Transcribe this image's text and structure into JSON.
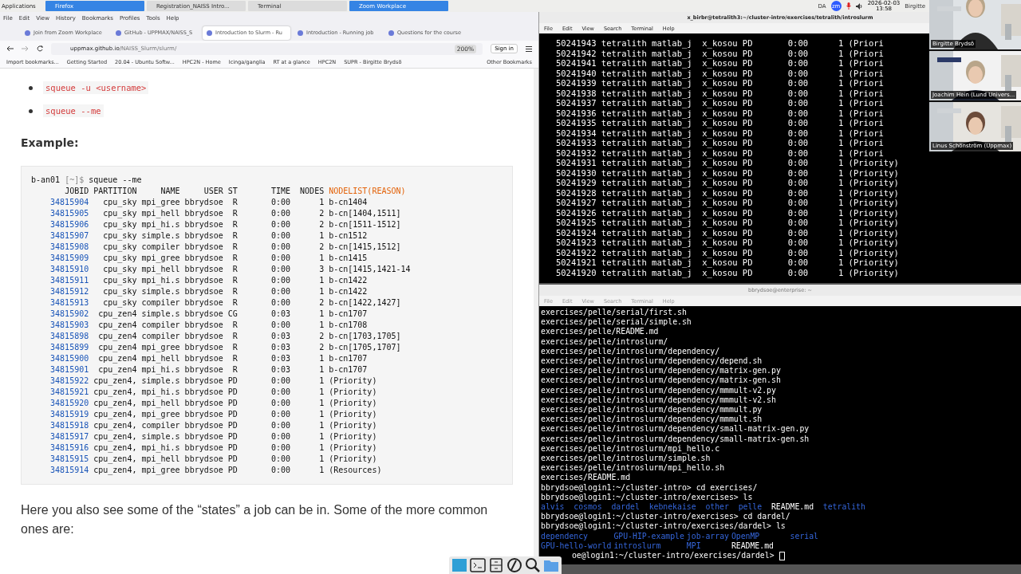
{
  "top_panel": {
    "menu": "Applications",
    "tasks": [
      {
        "label": "Firefox",
        "selected": true
      },
      {
        "label": "Registration_NAISS Intro...",
        "selected": false
      },
      {
        "label": "Terminal",
        "selected": false
      },
      {
        "label": "Zoom Workplace",
        "selected": true
      }
    ],
    "tray": {
      "lang": "DA",
      "zoom": "zm",
      "date": "2026-02-03",
      "time": "13:58",
      "user": "Birgitte"
    }
  },
  "browser": {
    "menu": [
      "File",
      "Edit",
      "View",
      "History",
      "Bookmarks",
      "Profiles",
      "Tools",
      "Help"
    ],
    "tabs": [
      {
        "label": "Join from Zoom Workplace",
        "selected": false
      },
      {
        "label": "GitHub - UPPMAX/NAISS_S",
        "selected": false
      },
      {
        "label": "Introduction to Slurm - Ru",
        "selected": true
      },
      {
        "label": "Introduction - Running job",
        "selected": false
      },
      {
        "label": "Questions for the course",
        "selected": false
      }
    ],
    "url_host": "uppmax.github.io",
    "url_path": "/NAISS_Slurm/slurm/",
    "zoom": "200%",
    "sign_in": "Sign in",
    "bookmarks": [
      "Import bookmarks...",
      "Getting Started",
      "20.04 - Ubuntu Softw...",
      "HPC2N - Home",
      "Icinga/ganglia",
      "RT at a glance",
      "HPC2N",
      "SUPR - Birgitte Brydsö"
    ],
    "other_bookmarks": "Other Bookmarks",
    "page": {
      "bullets": [
        "squeue -u <username>",
        "squeue --me"
      ],
      "heading": "Example:",
      "code": {
        "prompt_host": "b-an01",
        "prompt_dir": "[~]$",
        "command": "squeue --me",
        "header": [
          "JOBID",
          "PARTITION",
          "NAME",
          "USER",
          "ST",
          "TIME",
          "NODES",
          "NODELIST(REASON)"
        ],
        "rows": [
          [
            "34815904",
            "cpu_sky",
            "mpi_gree",
            "bbrydsoe",
            "R",
            "0:00",
            "1",
            "b-cn1404"
          ],
          [
            "34815905",
            "cpu_sky",
            "mpi_hell",
            "bbrydsoe",
            "R",
            "0:00",
            "2",
            "b-cn[1404,1511]"
          ],
          [
            "34815906",
            "cpu_sky",
            "mpi_hi.s",
            "bbrydsoe",
            "R",
            "0:00",
            "2",
            "b-cn[1511-1512]"
          ],
          [
            "34815907",
            "cpu_sky",
            "simple.s",
            "bbrydsoe",
            "R",
            "0:00",
            "1",
            "b-cn1512"
          ],
          [
            "34815908",
            "cpu_sky",
            "compiler",
            "bbrydsoe",
            "R",
            "0:00",
            "2",
            "b-cn[1415,1512]"
          ],
          [
            "34815909",
            "cpu_sky",
            "mpi_gree",
            "bbrydsoe",
            "R",
            "0:00",
            "1",
            "b-cn1415"
          ],
          [
            "34815910",
            "cpu_sky",
            "mpi_hell",
            "bbrydsoe",
            "R",
            "0:00",
            "3",
            "b-cn[1415,1421-14"
          ],
          [
            "34815911",
            "cpu_sky",
            "mpi_hi.s",
            "bbrydsoe",
            "R",
            "0:00",
            "1",
            "b-cn1422"
          ],
          [
            "34815912",
            "cpu_sky",
            "simple.s",
            "bbrydsoe",
            "R",
            "0:00",
            "1",
            "b-cn1422"
          ],
          [
            "34815913",
            "cpu_sky",
            "compiler",
            "bbrydsoe",
            "R",
            "0:00",
            "2",
            "b-cn[1422,1427]"
          ],
          [
            "34815902",
            "cpu_zen4",
            "simple.s",
            "bbrydsoe",
            "CG",
            "0:03",
            "1",
            "b-cn1707"
          ],
          [
            "34815903",
            "cpu_zen4",
            "compiler",
            "bbrydsoe",
            "R",
            "0:00",
            "1",
            "b-cn1708"
          ],
          [
            "34815898",
            "cpu_zen4",
            "compiler",
            "bbrydsoe",
            "R",
            "0:03",
            "2",
            "b-cn[1703,1705]"
          ],
          [
            "34815899",
            "cpu_zen4",
            "mpi_gree",
            "bbrydsoe",
            "R",
            "0:03",
            "2",
            "b-cn[1705,1707]"
          ],
          [
            "34815900",
            "cpu_zen4",
            "mpi_hell",
            "bbrydsoe",
            "R",
            "0:03",
            "1",
            "b-cn1707"
          ],
          [
            "34815901",
            "cpu_zen4",
            "mpi_hi.s",
            "bbrydsoe",
            "R",
            "0:03",
            "1",
            "b-cn1707"
          ],
          [
            "34815922",
            "cpu_zen4,",
            "simple.s",
            "bbrydsoe",
            "PD",
            "0:00",
            "1",
            "(Priority)"
          ],
          [
            "34815921",
            "cpu_zen4,",
            "mpi_hi.s",
            "bbrydsoe",
            "PD",
            "0:00",
            "1",
            "(Priority)"
          ],
          [
            "34815920",
            "cpu_zen4,",
            "mpi_hell",
            "bbrydsoe",
            "PD",
            "0:00",
            "1",
            "(Priority)"
          ],
          [
            "34815919",
            "cpu_zen4,",
            "mpi_gree",
            "bbrydsoe",
            "PD",
            "0:00",
            "1",
            "(Priority)"
          ],
          [
            "34815918",
            "cpu_zen4,",
            "compiler",
            "bbrydsoe",
            "PD",
            "0:00",
            "1",
            "(Priority)"
          ],
          [
            "34815917",
            "cpu_zen4,",
            "simple.s",
            "bbrydsoe",
            "PD",
            "0:00",
            "1",
            "(Priority)"
          ],
          [
            "34815916",
            "cpu_zen4,",
            "mpi_hi.s",
            "bbrydsoe",
            "PD",
            "0:00",
            "1",
            "(Priority)"
          ],
          [
            "34815915",
            "cpu_zen4,",
            "mpi_hell",
            "bbrydsoe",
            "PD",
            "0:00",
            "1",
            "(Priority)"
          ],
          [
            "34815914",
            "cpu_zen4,",
            "mpi_gree",
            "bbrydsoe",
            "PD",
            "0:00",
            "1",
            "(Resources)"
          ]
        ]
      },
      "paragraph": "Here you also see some of the “states” a job can be in. Some of the more common ones are:"
    }
  },
  "terminal_top": {
    "title": "x_birbr@tetralith3:~/cluster-intro/exercises/tetralith/introslurm",
    "menu": [
      "File",
      "Edit",
      "View",
      "Search",
      "Terminal",
      "Help"
    ],
    "lines": [
      "   50241943 tetralith matlab_j  x_kosou PD       0:00      1 (Priori",
      "   50241942 tetralith matlab_j  x_kosou PD       0:00      1 (Priori",
      "   50241941 tetralith matlab_j  x_kosou PD       0:00      1 (Priori",
      "   50241940 tetralith matlab_j  x_kosou PD       0:00      1 (Priori",
      "   50241939 tetralith matlab_j  x_kosou PD       0:00      1 (Priori",
      "   50241938 tetralith matlab_j  x_kosou PD       0:00      1 (Priori",
      "   50241937 tetralith matlab_j  x_kosou PD       0:00      1 (Priori",
      "   50241936 tetralith matlab_j  x_kosou PD       0:00      1 (Priori",
      "   50241935 tetralith matlab_j  x_kosou PD       0:00      1 (Priori",
      "   50241934 tetralith matlab_j  x_kosou PD       0:00      1 (Priori",
      "   50241933 tetralith matlab_j  x_kosou PD       0:00      1 (Priori",
      "   50241932 tetralith matlab_j  x_kosou PD       0:00      1 (Priori",
      "   50241931 tetralith matlab_j  x_kosou PD       0:00      1 (Priority)",
      "   50241930 tetralith matlab_j  x_kosou PD       0:00      1 (Priority)",
      "   50241929 tetralith matlab_j  x_kosou PD       0:00      1 (Priority)",
      "   50241928 tetralith matlab_j  x_kosou PD       0:00      1 (Priority)",
      "   50241927 tetralith matlab_j  x_kosou PD       0:00      1 (Priority)",
      "   50241926 tetralith matlab_j  x_kosou PD       0:00      1 (Priority)",
      "   50241925 tetralith matlab_j  x_kosou PD       0:00      1 (Priority)",
      "   50241924 tetralith matlab_j  x_kosou PD       0:00      1 (Priority)",
      "   50241923 tetralith matlab_j  x_kosou PD       0:00      1 (Priority)",
      "   50241922 tetralith matlab_j  x_kosou PD       0:00      1 (Priority)",
      "   50241921 tetralith matlab_j  x_kosou PD       0:00      1 (Priority)",
      "   50241920 tetralith matlab_j  x_kosou PD       0:00      1 (Priority)"
    ]
  },
  "terminal_bottom": {
    "title": "bbrydsoe@enterprise: ~",
    "menu": [
      "File",
      "Edit",
      "View",
      "Search",
      "Terminal",
      "Help"
    ],
    "lines": [
      {
        "kind": "text",
        "text": "exercises/pelle/serial/first.sh"
      },
      {
        "kind": "text",
        "text": "exercises/pelle/serial/simple.sh"
      },
      {
        "kind": "text",
        "text": "exercises/pelle/README.md"
      },
      {
        "kind": "text",
        "text": "exercises/pelle/introslurm/"
      },
      {
        "kind": "text",
        "text": "exercises/pelle/introslurm/dependency/"
      },
      {
        "kind": "text",
        "text": "exercises/pelle/introslurm/dependency/depend.sh"
      },
      {
        "kind": "text",
        "text": "exercises/pelle/introslurm/dependency/matrix-gen.py"
      },
      {
        "kind": "text",
        "text": "exercises/pelle/introslurm/dependency/matrix-gen.sh"
      },
      {
        "kind": "text",
        "text": "exercises/pelle/introslurm/dependency/mmmult-v2.py"
      },
      {
        "kind": "text",
        "text": "exercises/pelle/introslurm/dependency/mmmult-v2.sh"
      },
      {
        "kind": "text",
        "text": "exercises/pelle/introslurm/dependency/mmmult.py"
      },
      {
        "kind": "text",
        "text": "exercises/pelle/introslurm/dependency/mmmult.sh"
      },
      {
        "kind": "text",
        "text": "exercises/pelle/introslurm/dependency/small-matrix-gen.py"
      },
      {
        "kind": "text",
        "text": "exercises/pelle/introslurm/dependency/small-matrix-gen.sh"
      },
      {
        "kind": "text",
        "text": "exercises/pelle/introslurm/mpi_hello.c"
      },
      {
        "kind": "text",
        "text": "exercises/pelle/introslurm/simple.sh"
      },
      {
        "kind": "text",
        "text": "exercises/pelle/introslurm/mpi_hello.sh"
      },
      {
        "kind": "text",
        "text": "exercises/README.md"
      },
      {
        "kind": "text",
        "text": "bbrydsoe@login1:~/cluster-intro> cd exercises/"
      },
      {
        "kind": "text",
        "text": "bbrydsoe@login1:~/cluster-intro/exercises> ls"
      },
      {
        "kind": "ls",
        "items": [
          {
            "text": "alvis",
            "dir": true
          },
          {
            "text": "cosmos",
            "dir": true
          },
          {
            "text": "dardel",
            "dir": true
          },
          {
            "text": "kebnekaise",
            "dir": true
          },
          {
            "text": "other",
            "dir": true
          },
          {
            "text": "pelle",
            "dir": true
          },
          {
            "text": "README.md",
            "dir": false
          },
          {
            "text": "tetralith",
            "dir": true
          }
        ]
      },
      {
        "kind": "text",
        "text": "bbrydsoe@login1:~/cluster-intro/exercises> cd dardel/"
      },
      {
        "kind": "text",
        "text": "bbrydsoe@login1:~/cluster-intro/exercises/dardel> ls"
      },
      {
        "kind": "columns",
        "items": [
          {
            "text": "dependency",
            "dir": true
          },
          {
            "text": "GPU-HIP-example",
            "dir": true
          },
          {
            "text": "job-array",
            "dir": true
          },
          {
            "text": "OpenMP",
            "dir": true
          },
          {
            "text": "serial",
            "dir": true
          }
        ]
      },
      {
        "kind": "columns",
        "items": [
          {
            "text": "GPU-hello-world",
            "dir": true
          },
          {
            "text": "introslurm",
            "dir": true
          },
          {
            "text": "MPI",
            "dir": true
          },
          {
            "text": "README.md",
            "dir": false
          }
        ]
      },
      {
        "kind": "prompt",
        "text": "oe@login1:~/cluster-intro/exercises/dardel>"
      }
    ]
  },
  "video": [
    {
      "name": "Birgitte Brydsö"
    },
    {
      "name": "Joachim Hein (Lund Univers..."
    },
    {
      "name": "Linus Schönström (Uppmax)"
    }
  ]
}
